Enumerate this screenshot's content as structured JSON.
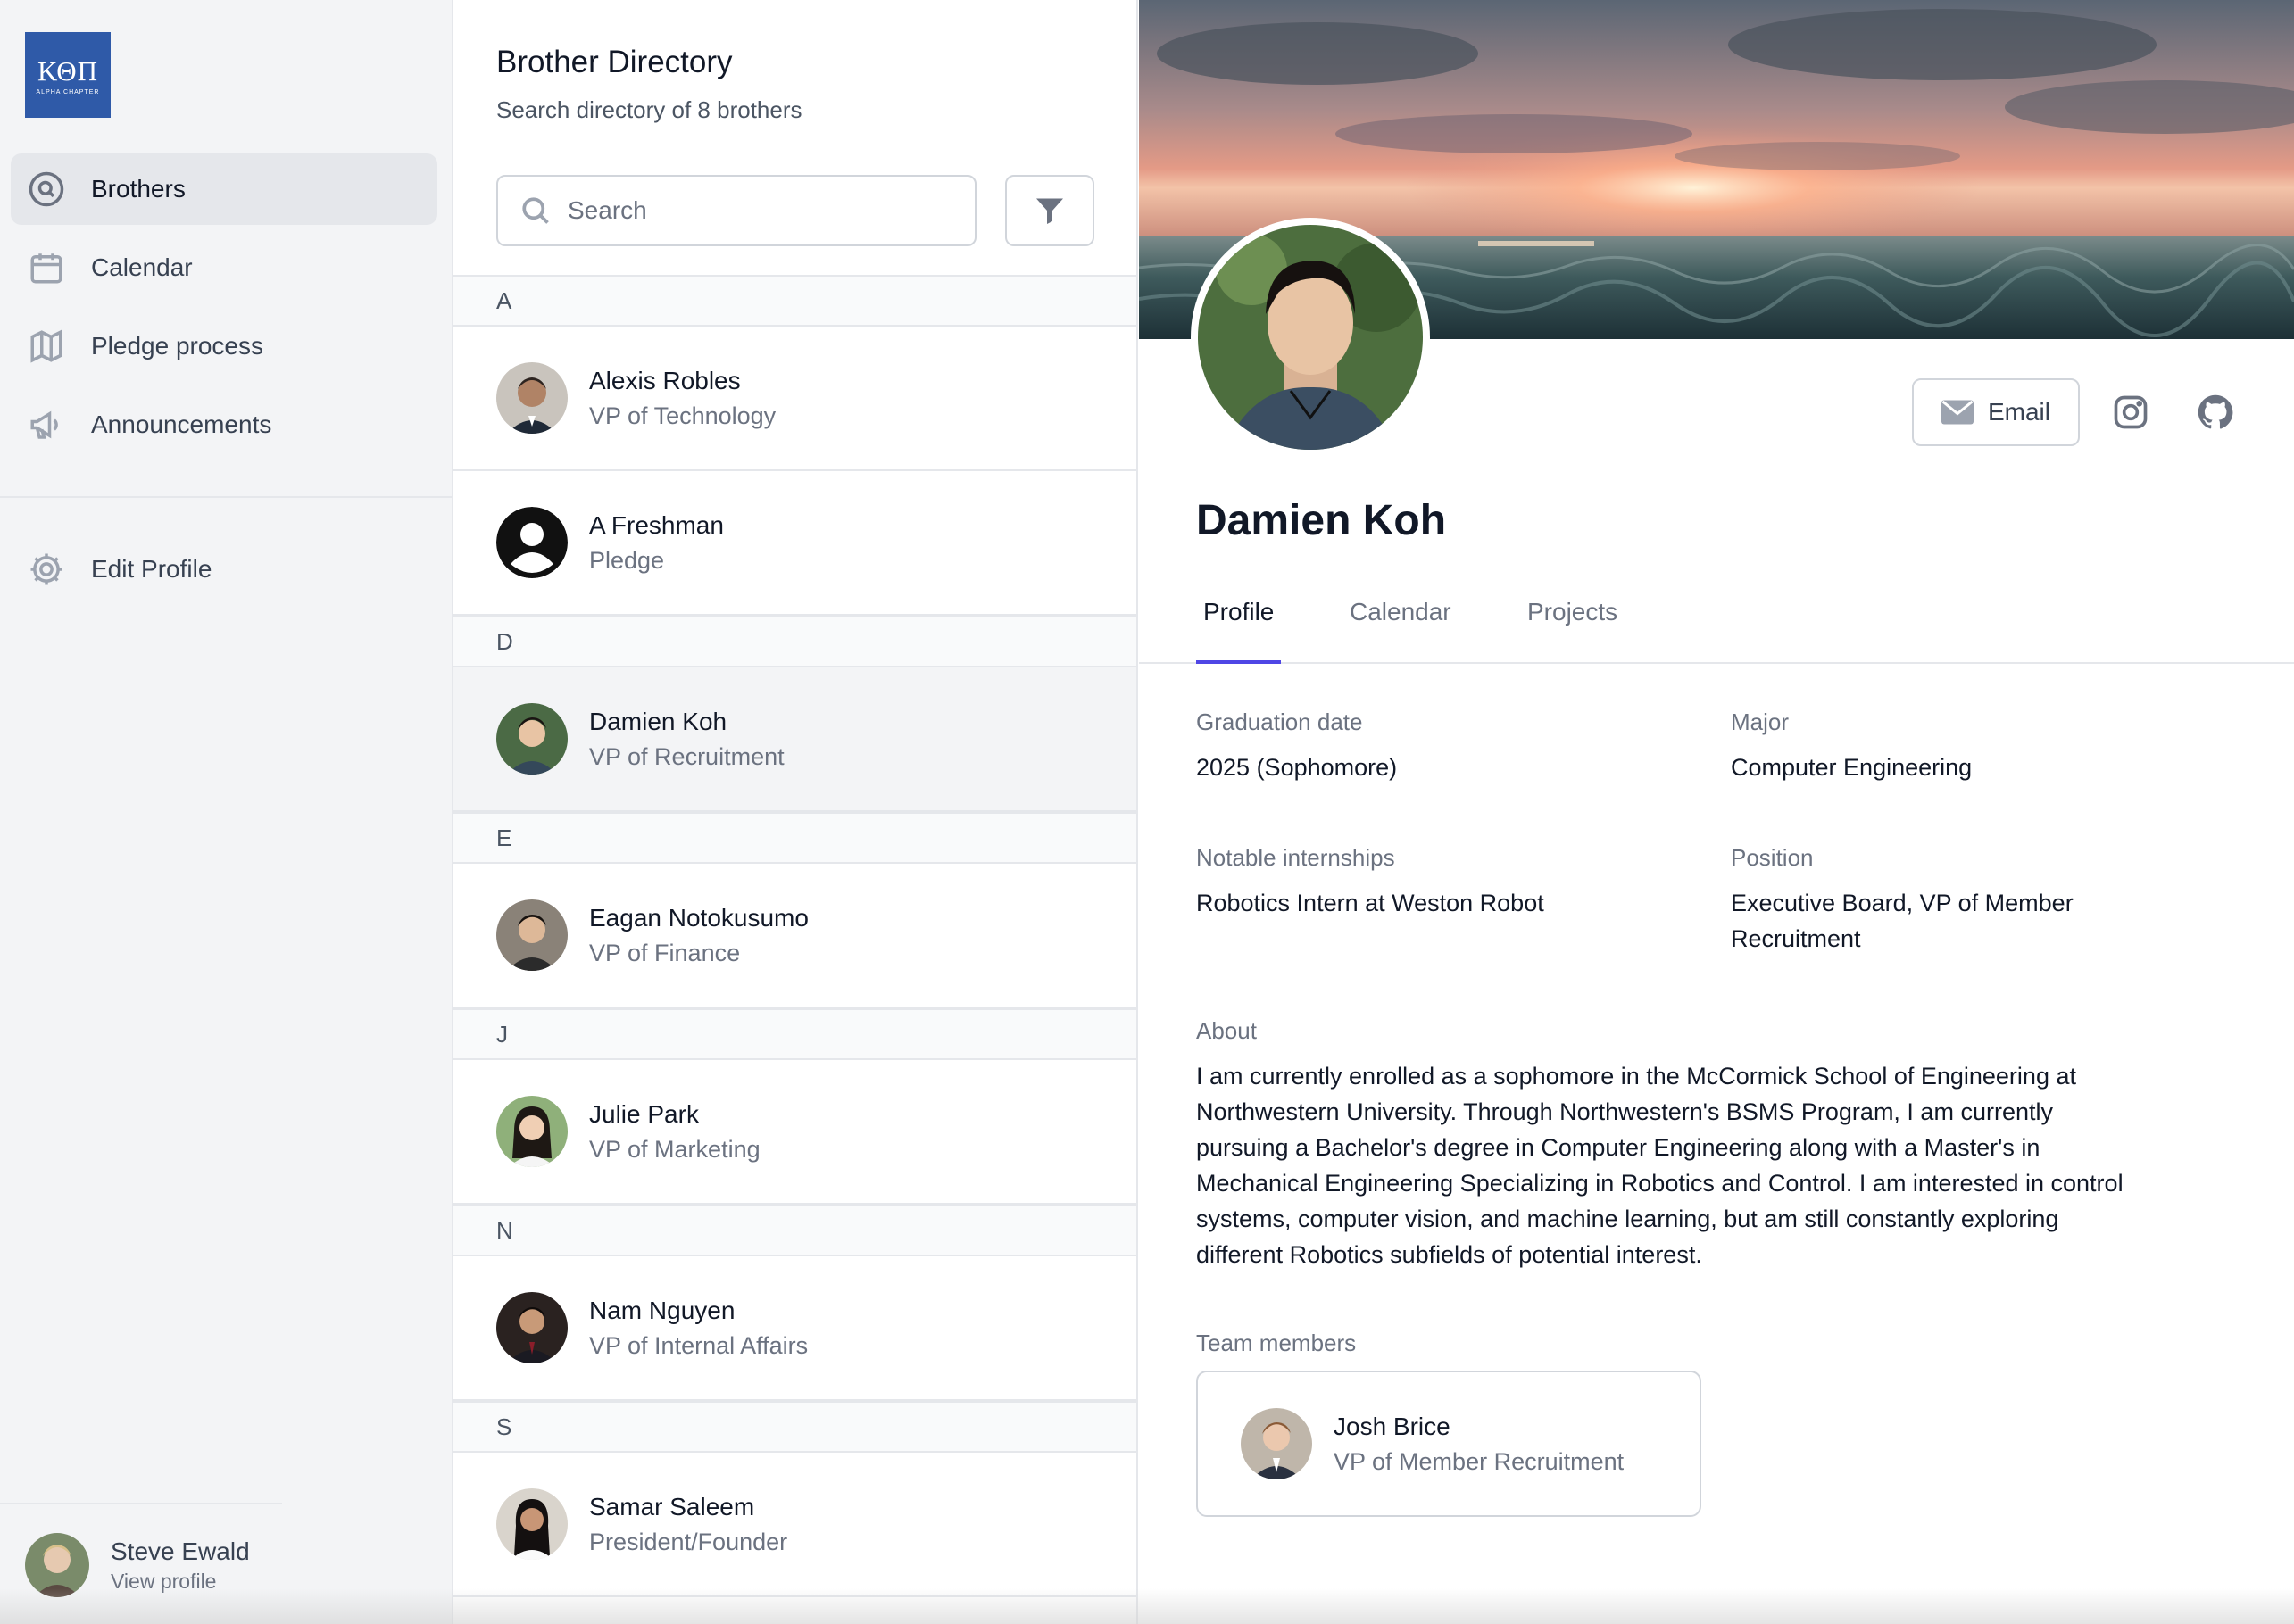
{
  "logo": {
    "letters": "ΚΘΠ",
    "chapter": "ALPHA CHAPTER"
  },
  "sidebar": {
    "items": [
      {
        "label": "Brothers",
        "icon": "search-circle-icon"
      },
      {
        "label": "Calendar",
        "icon": "calendar-icon"
      },
      {
        "label": "Pledge process",
        "icon": "map-icon"
      },
      {
        "label": "Announcements",
        "icon": "megaphone-icon"
      }
    ],
    "secondary": [
      {
        "label": "Edit Profile",
        "icon": "gear-icon"
      }
    ],
    "user": {
      "name": "Steve Ewald",
      "link": "View profile"
    }
  },
  "directory": {
    "title": "Brother Directory",
    "subtitle": "Search directory of 8 brothers",
    "search_placeholder": "Search",
    "sections": [
      {
        "letter": "A",
        "people": [
          {
            "name": "Alexis Robles",
            "position": "VP of Technology"
          },
          {
            "name": "A Freshman",
            "position": "Pledge"
          }
        ]
      },
      {
        "letter": "D",
        "people": [
          {
            "name": "Damien Koh",
            "position": "VP of Recruitment"
          }
        ]
      },
      {
        "letter": "E",
        "people": [
          {
            "name": "Eagan Notokusumo",
            "position": "VP of Finance"
          }
        ]
      },
      {
        "letter": "J",
        "people": [
          {
            "name": "Julie Park",
            "position": "VP of Marketing"
          }
        ]
      },
      {
        "letter": "N",
        "people": [
          {
            "name": "Nam Nguyen",
            "position": "VP of Internal Affairs"
          }
        ]
      },
      {
        "letter": "S",
        "people": [
          {
            "name": "Samar Saleem",
            "position": "President/Founder"
          }
        ]
      }
    ]
  },
  "profile": {
    "name": "Damien Koh",
    "email_label": "Email",
    "tabs": [
      "Profile",
      "Calendar",
      "Projects"
    ],
    "fields": {
      "graduation_label": "Graduation date",
      "graduation_value": "2025 (Sophomore)",
      "major_label": "Major",
      "major_value": "Computer Engineering",
      "internships_label": "Notable internships",
      "internships_value": "Robotics Intern at Weston Robot",
      "position_label": "Position",
      "position_value_1": "Executive Board, VP of Member",
      "position_value_2": "Recruitment"
    },
    "about_label": "About",
    "about_lines": [
      "I am currently enrolled as a sophomore in the McCormick School of Engineering at",
      "Northwestern University. Through Northwestern's BSMS Program, I am currently",
      "pursuing a Bachelor's degree in Computer Engineering along with a Master's in",
      "Mechanical Engineering Specializing in Robotics and Control. I am interested in control",
      "systems, computer vision, and machine learning, but am still constantly exploring",
      "different Robotics subfields of potential interest."
    ],
    "team_label": "Team members",
    "team": [
      {
        "name": "Josh Brice",
        "position": "VP of Member Recruitment"
      }
    ]
  },
  "colors": {
    "accent": "#4f46e5",
    "logo_bg": "#2f5aa8",
    "sidebar_bg": "#f3f4f6"
  }
}
